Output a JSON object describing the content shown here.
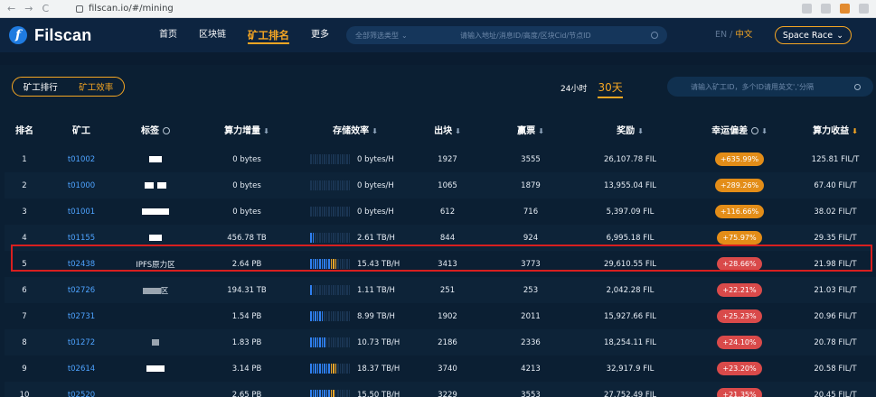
{
  "browser": {
    "url": "filscan.io/#/mining"
  },
  "header": {
    "logo": "Filscan",
    "nav": [
      "首页",
      "区块链",
      "矿工排名",
      "更多"
    ],
    "active_nav": 2,
    "search_type": "全部筛选类型",
    "search_placeholder": "请输入地址/消息ID/高度/区块Cid/节点ID",
    "lang_en": "EN",
    "lang_sep": "/",
    "lang_zh": "中文",
    "space_race": "Space Race"
  },
  "toolbar": {
    "tabs": [
      "矿工排行",
      "矿工效率"
    ],
    "active_tab": 1,
    "ranges": [
      "24小时",
      "30天"
    ],
    "active_range": 1,
    "miner_search_placeholder": "请输入矿工ID，多个ID请用英文','分隔"
  },
  "table": {
    "columns": [
      "排名",
      "矿工",
      "标签",
      "算力增量",
      "存储效率",
      "出块",
      "赢票",
      "奖励",
      "幸运偏差",
      "算力收益"
    ],
    "rows": [
      {
        "rank": "1",
        "miner": "t01002",
        "tag": "",
        "power_inc": "0 bytes",
        "efficiency": "0 bytes/H",
        "blocks": "1927",
        "wins": "3555",
        "reward": "26,107.78 FIL",
        "luck": "+635.99%",
        "luck_color": "orange",
        "yield": "125.81 FIL/T",
        "bar_level": 0,
        "bar_yellow": 0
      },
      {
        "rank": "2",
        "miner": "t01000",
        "tag": "",
        "power_inc": "0 bytes",
        "efficiency": "0 bytes/H",
        "blocks": "1065",
        "wins": "1879",
        "reward": "13,955.04 FIL",
        "luck": "+289.26%",
        "luck_color": "orange",
        "yield": "67.40 FIL/T",
        "bar_level": 0,
        "bar_yellow": 0
      },
      {
        "rank": "3",
        "miner": "t01001",
        "tag": "",
        "power_inc": "0 bytes",
        "efficiency": "0 bytes/H",
        "blocks": "612",
        "wins": "716",
        "reward": "5,397.09 FIL",
        "luck": "+116.66%",
        "luck_color": "orange",
        "yield": "38.02 FIL/T",
        "bar_level": 0,
        "bar_yellow": 0
      },
      {
        "rank": "4",
        "miner": "t01155",
        "tag": "",
        "power_inc": "456.78 TB",
        "efficiency": "2.61 TB/H",
        "blocks": "844",
        "wins": "924",
        "reward": "6,995.18 FIL",
        "luck": "+75.97%",
        "luck_color": "orange",
        "yield": "29.35 FIL/T",
        "bar_level": 2,
        "bar_yellow": 0
      },
      {
        "rank": "5",
        "miner": "t02438",
        "tag": "IPFS原力区",
        "power_inc": "2.64 PB",
        "efficiency": "15.43 TB/H",
        "blocks": "3413",
        "wins": "3773",
        "reward": "29,610.55 FIL",
        "luck": "+28.66%",
        "luck_color": "red",
        "yield": "21.98 FIL/T",
        "bar_level": 9,
        "bar_yellow": 3
      },
      {
        "rank": "6",
        "miner": "t02726",
        "tag": "区",
        "power_inc": "194.31 TB",
        "efficiency": "1.11 TB/H",
        "blocks": "251",
        "wins": "253",
        "reward": "2,042.28 FIL",
        "luck": "+22.21%",
        "luck_color": "red",
        "yield": "21.03 FIL/T",
        "bar_level": 1,
        "bar_yellow": 0
      },
      {
        "rank": "7",
        "miner": "t02731",
        "tag": "",
        "power_inc": "1.54 PB",
        "efficiency": "8.99 TB/H",
        "blocks": "1902",
        "wins": "2011",
        "reward": "15,927.66 FIL",
        "luck": "+25.23%",
        "luck_color": "red",
        "yield": "20.96 FIL/T",
        "bar_level": 6,
        "bar_yellow": 0
      },
      {
        "rank": "8",
        "miner": "t01272",
        "tag": "",
        "power_inc": "1.83 PB",
        "efficiency": "10.73 TB/H",
        "blocks": "2186",
        "wins": "2336",
        "reward": "18,254.11 FIL",
        "luck": "+24.10%",
        "luck_color": "red",
        "yield": "20.78 FIL/T",
        "bar_level": 7,
        "bar_yellow": 0
      },
      {
        "rank": "9",
        "miner": "t02614",
        "tag": "",
        "power_inc": "3.14 PB",
        "efficiency": "18.37 TB/H",
        "blocks": "3740",
        "wins": "4213",
        "reward": "32,917.9 FIL",
        "luck": "+23.20%",
        "luck_color": "red",
        "yield": "20.58 FIL/T",
        "bar_level": 9,
        "bar_yellow": 3
      },
      {
        "rank": "10",
        "miner": "t02520",
        "tag": "",
        "power_inc": "2.65 PB",
        "efficiency": "15.50 TB/H",
        "blocks": "3229",
        "wins": "3553",
        "reward": "27,752.49 FIL",
        "luck": "+21.35%",
        "luck_color": "red",
        "yield": "20.45 FIL/T",
        "bar_level": 9,
        "bar_yellow": 2
      }
    ]
  }
}
